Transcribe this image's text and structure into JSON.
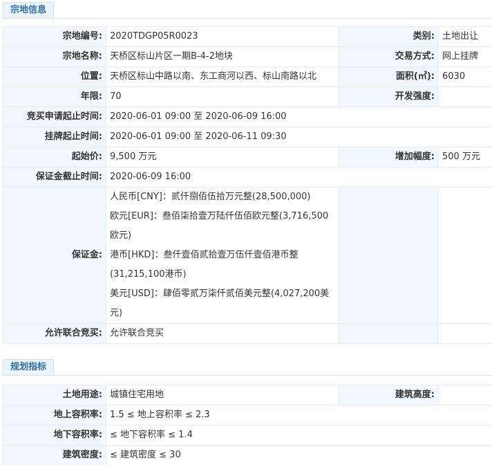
{
  "sections": {
    "parcel_info": "宗地信息",
    "planning": "规划指标"
  },
  "parcel": {
    "code_label": "宗地编号:",
    "code_value": "2020TDGP05R0023",
    "category_label": "类别:",
    "category_value": "土地出让",
    "name_label": "宗地名称:",
    "name_value": "天桥区标山片区一期B-4-2地块",
    "trade_label": "交易方式:",
    "trade_value": "网上挂牌",
    "location_label": "位置:",
    "location_value": "天桥区标山中路以南、东工商河以西、标山南路以北",
    "area_label": "面积(㎡):",
    "area_value": "6030",
    "term_label": "年限:",
    "term_value": "70",
    "intensity_label": "开发强度:",
    "intensity_value": "",
    "apply_label": "竞买申请起止时间:",
    "apply_value": "2020-06-01 09:00 至 2020-06-09 16:00",
    "listing_label": "挂牌起止时间:",
    "listing_value": "2020-06-01 09:00 至 2020-06-11 09:30",
    "start_price_label": "起始价:",
    "start_price_value": "9,500 万元",
    "increment_label": "增加幅度:",
    "increment_value": "500 万元",
    "deposit_deadline_label": "保证金截止时间:",
    "deposit_deadline_value": "2020-06-09 16:00",
    "deposit_label": "保证金:",
    "deposit_lines": [
      "人民币[CNY]：贰仟捌佰伍拾万元整(28,500,000)",
      "欧元[EUR]：叁佰柒拾壹万陆仟伍佰欧元整(3,716,500",
      "欧元)",
      "港币[HKD]：叁仟壹佰贰拾壹万伍仟壹佰港币整",
      "(31,215,100港币)",
      "美元[USD]：肆佰零贰万柒仟贰佰美元整(4,027,200美",
      "元)"
    ],
    "joint_label": "允许联合竞买:",
    "joint_value": "允许联合竞买"
  },
  "planning": {
    "use_label": "土地用途:",
    "use_value": "城镇住宅用地",
    "height_label": "建筑高度:",
    "height_value": "",
    "far_above_label": "地上容积率:",
    "far_above_value": "1.5 ≤ 地上容积率 ≤ 2.3",
    "far_below_label": "地下容积率:",
    "far_below_value": "≤ 地下容积率 ≤ 1.4",
    "density_label": "建筑密度:",
    "density_value": "≤ 建筑密度 ≤ 30"
  }
}
